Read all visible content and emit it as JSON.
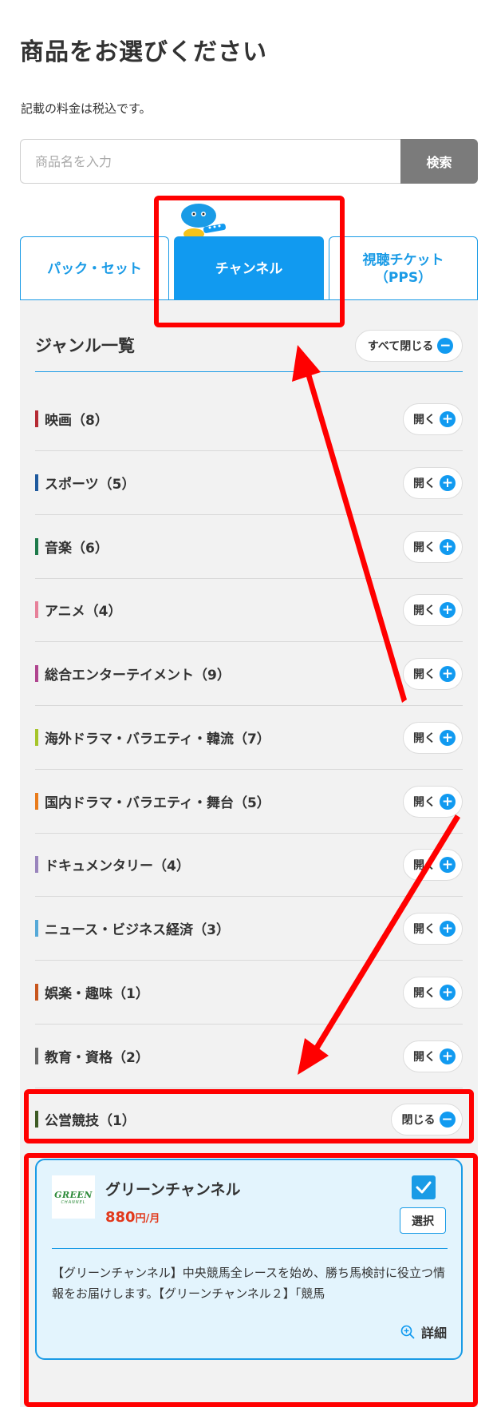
{
  "page": {
    "title": "商品をお選びください",
    "tax_note": "記載の料金は税込です。"
  },
  "search": {
    "placeholder": "商品名を入力",
    "button_label": "検索"
  },
  "tabs": [
    {
      "label": "パック・セット",
      "active": false
    },
    {
      "label": "チャンネル",
      "active": true
    },
    {
      "label": "視聴チケット\n（PPS）",
      "active": false
    }
  ],
  "genre_list": {
    "title": "ジャンル一覧",
    "close_all_label": "すべて閉じる",
    "open_label": "開く",
    "close_label": "閉じる",
    "items": [
      {
        "label": "映画（8）",
        "color": "#b52b34"
      },
      {
        "label": "スポーツ（5）",
        "color": "#1f5a9e"
      },
      {
        "label": "音楽（6）",
        "color": "#1e7a4a"
      },
      {
        "label": "アニメ（4）",
        "color": "#e7819a"
      },
      {
        "label": "総合エンターテイメント（9）",
        "color": "#b0458f"
      },
      {
        "label": "海外ドラマ・バラエティ・韓流（7）",
        "color": "#a6c52a"
      },
      {
        "label": "国内ドラマ・バラエティ・舞台（5）",
        "color": "#e97b1b"
      },
      {
        "label": "ドキュメンタリー（4）",
        "color": "#9a85bd"
      },
      {
        "label": "ニュース・ビジネス経済（3）",
        "color": "#56a9d8"
      },
      {
        "label": "娯楽・趣味（1）",
        "color": "#c8561d"
      },
      {
        "label": "教育・資格（2）",
        "color": "#6a6a6a"
      },
      {
        "label": "公営競技（1）",
        "color": "#3d5b25",
        "expanded": true
      }
    ]
  },
  "channel": {
    "name": "グリーンチャンネル",
    "logo_text": "GREEN",
    "logo_sub": "CHANNEL",
    "price": "880",
    "price_unit": "円/月",
    "select_label": "選択",
    "selected": true,
    "description": "【グリーンチャンネル】中央競馬全レースを始め、勝ち馬検討に役立つ情報をお届けします。【グリーンチャンネル２】「競馬",
    "detail_label": "詳細"
  },
  "colors": {
    "accent": "#119af0",
    "price": "#e2391c",
    "annotation": "#ff0000",
    "panel_bg": "#f2f2f2",
    "card_bg": "#e3f4fd"
  },
  "icons": {
    "open": "plus-circle-icon",
    "close": "minus-circle-icon",
    "check": "check-icon",
    "zoom": "zoom-in-icon",
    "mascot": "mascot-icon"
  }
}
